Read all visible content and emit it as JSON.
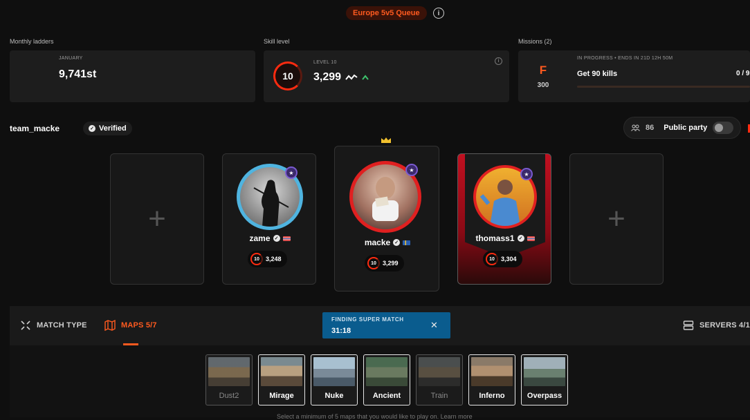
{
  "header": {
    "queue": "Europe 5v5 Queue",
    "info_glyph": "i"
  },
  "ladders": {
    "label": "Monthly ladders",
    "month": "JANUARY",
    "rank": "9,741st"
  },
  "skill": {
    "label": "Skill level",
    "level_label": "LEVEL 10",
    "level": "10",
    "elo": "3,299",
    "trend": "up"
  },
  "missions": {
    "label": "Missions (2)",
    "status": "IN PROGRESS • ENDS IN 21D 12H 50M",
    "title": "Get 90 kills",
    "progress": "0 / 9",
    "reward": "300",
    "reward_icon": "F",
    "progress_fraction": 0
  },
  "party": {
    "name": "team_macke",
    "verified": "Verified",
    "count": "86",
    "public_label": "Public party",
    "public_on": false
  },
  "slots": {
    "empty_glyph": "+",
    "players": [
      {
        "name": "zame",
        "elo": "3,248",
        "level": "10",
        "flag": "Norway"
      },
      {
        "name": "macke",
        "elo": "3,299",
        "level": "10",
        "flag": "Sweden",
        "leader": true
      },
      {
        "name": "thomass1",
        "elo": "3,304",
        "level": "10",
        "flag": "Norway"
      }
    ]
  },
  "tabs": {
    "match_type": "MATCH TYPE",
    "maps": "MAPS 5/7",
    "servers": "SERVERS 4/1"
  },
  "finding": {
    "label": "FINDING SUPER MATCH",
    "timer": "31:18",
    "close": "✕"
  },
  "maps": [
    {
      "name": "Dust2",
      "selected": false
    },
    {
      "name": "Mirage",
      "selected": true
    },
    {
      "name": "Nuke",
      "selected": true
    },
    {
      "name": "Ancient",
      "selected": true
    },
    {
      "name": "Train",
      "selected": false
    },
    {
      "name": "Inferno",
      "selected": true
    },
    {
      "name": "Overpass",
      "selected": true
    }
  ],
  "hint": "Select a minimum of 5 maps that you would like to play on. Learn more",
  "colors": {
    "accent": "#ff5a1f",
    "finding": "#0a5c8e",
    "level_red": "#ff2b10",
    "leader_crown": "#f2c12e"
  }
}
